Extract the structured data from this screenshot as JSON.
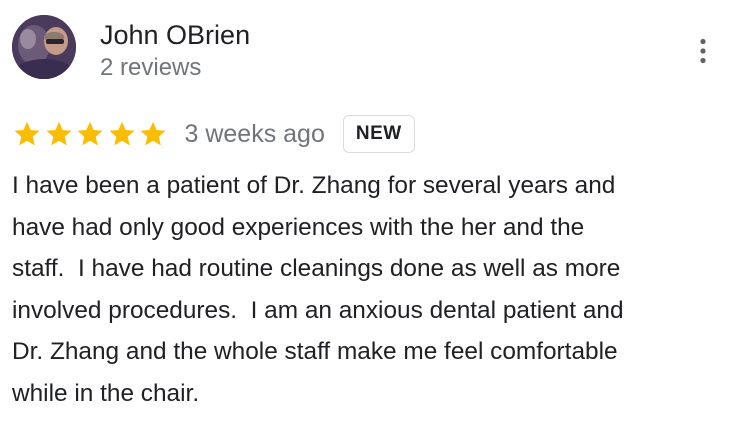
{
  "review": {
    "author_name": "John OBrien",
    "review_count": "2 reviews",
    "rating": 5,
    "max_rating": 5,
    "date": "3 weeks ago",
    "badge": "NEW",
    "text_lines": [
      "I have been a patient of Dr. Zhang for several years and",
      "have had only good experiences with the her and the",
      "staff.  I have had routine cleanings done as well as more",
      "involved procedures.  I am an anxious dental patient and",
      "Dr. Zhang and the whole staff make me feel comfortable",
      "while in the chair."
    ]
  },
  "icons": {
    "avatar": "profile-photo",
    "star": "star-icon",
    "more": "more-vert-icon"
  },
  "colors": {
    "star": "#fbbc04",
    "text_primary": "#202124",
    "text_secondary": "#70757a",
    "badge_border": "#dadce0"
  }
}
